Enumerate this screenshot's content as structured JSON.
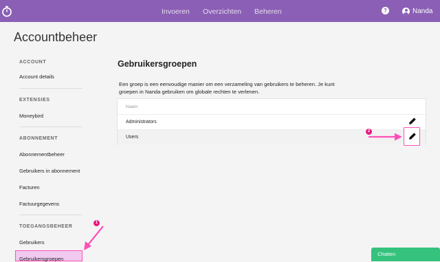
{
  "nav": {
    "items": [
      "Invoeren",
      "Overzichten",
      "Beheren"
    ],
    "help_symbol": "?",
    "user_name": "Nanda"
  },
  "page": {
    "title": "Accountbeheer"
  },
  "sidebar": {
    "sections": [
      {
        "heading": "ACCOUNT",
        "items": [
          "Account details"
        ]
      },
      {
        "heading": "EXTENSIES",
        "items": [
          "Moneybird"
        ]
      },
      {
        "heading": "ABONNEMENT",
        "items": [
          "Abonnementbeheer",
          "Gebruikers in abonnement",
          "Facturen",
          "Factuurgegevens"
        ]
      },
      {
        "heading": "TOEGANGSBEHEER",
        "items": [
          "Gebruikers",
          "Gebruikersgroepen"
        ]
      }
    ]
  },
  "main": {
    "title": "Gebruikersgroepen",
    "description": "Een groep is een eenvoudige manier om een verzameling van gebruikers te beheren. Je kunt groepen in Nanda gebruiken om globale rechten te verlenen.",
    "table": {
      "column": "Naam",
      "rows": [
        "Administrators",
        "Users"
      ]
    }
  },
  "annotations": {
    "badge1": "1",
    "badge2": "2",
    "color": "#ff4fb8"
  },
  "chat": {
    "label": "Chatten"
  },
  "colors": {
    "topbar": "#8b5fb5",
    "chat": "#35c27d",
    "highlight": "#ff4fb8"
  },
  "icons": {
    "logo": "stopwatch-logo-icon",
    "edit": "pencil-icon",
    "help": "help-circle-icon",
    "user": "user-circle-icon"
  }
}
